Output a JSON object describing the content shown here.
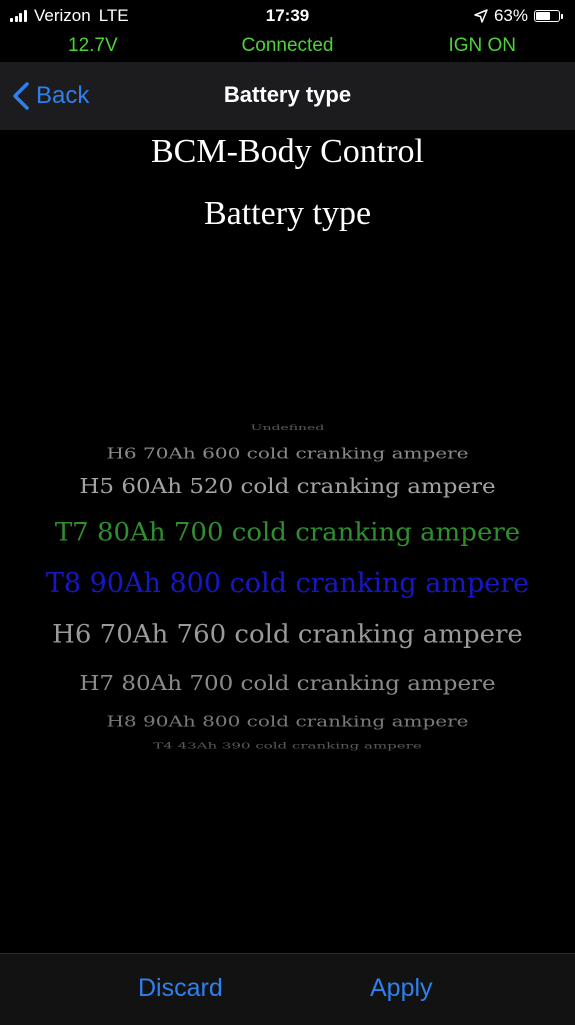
{
  "status_bar": {
    "carrier": "Verizon",
    "network": "LTE",
    "time": "17:39",
    "battery_percent": "63%",
    "battery_level": 0.63
  },
  "connection": {
    "voltage": "12.7V",
    "status": "Connected",
    "ignition": "IGN ON",
    "color": "#4cd337"
  },
  "nav": {
    "back_label": "Back",
    "title": "Battery type",
    "accent": "#2f80ed"
  },
  "heading": {
    "module": "BCM-Body Control",
    "setting": "Battery type"
  },
  "picker": {
    "selected_index": 4,
    "items": [
      "Undefined",
      "H6 70Ah 600 cold cranking ampere",
      "H5 60Ah 520 cold cranking ampere",
      "T7 80Ah 700 cold cranking ampere",
      "T8 90Ah 800 cold cranking ampere",
      "H6 70Ah 760 cold cranking ampere",
      "H7 80Ah 700 cold cranking ampere",
      "H8 90Ah 800 cold cranking ampere",
      "T4 43Ah 390 cold cranking ampere"
    ]
  },
  "toolbar": {
    "discard_label": "Discard",
    "apply_label": "Apply"
  }
}
